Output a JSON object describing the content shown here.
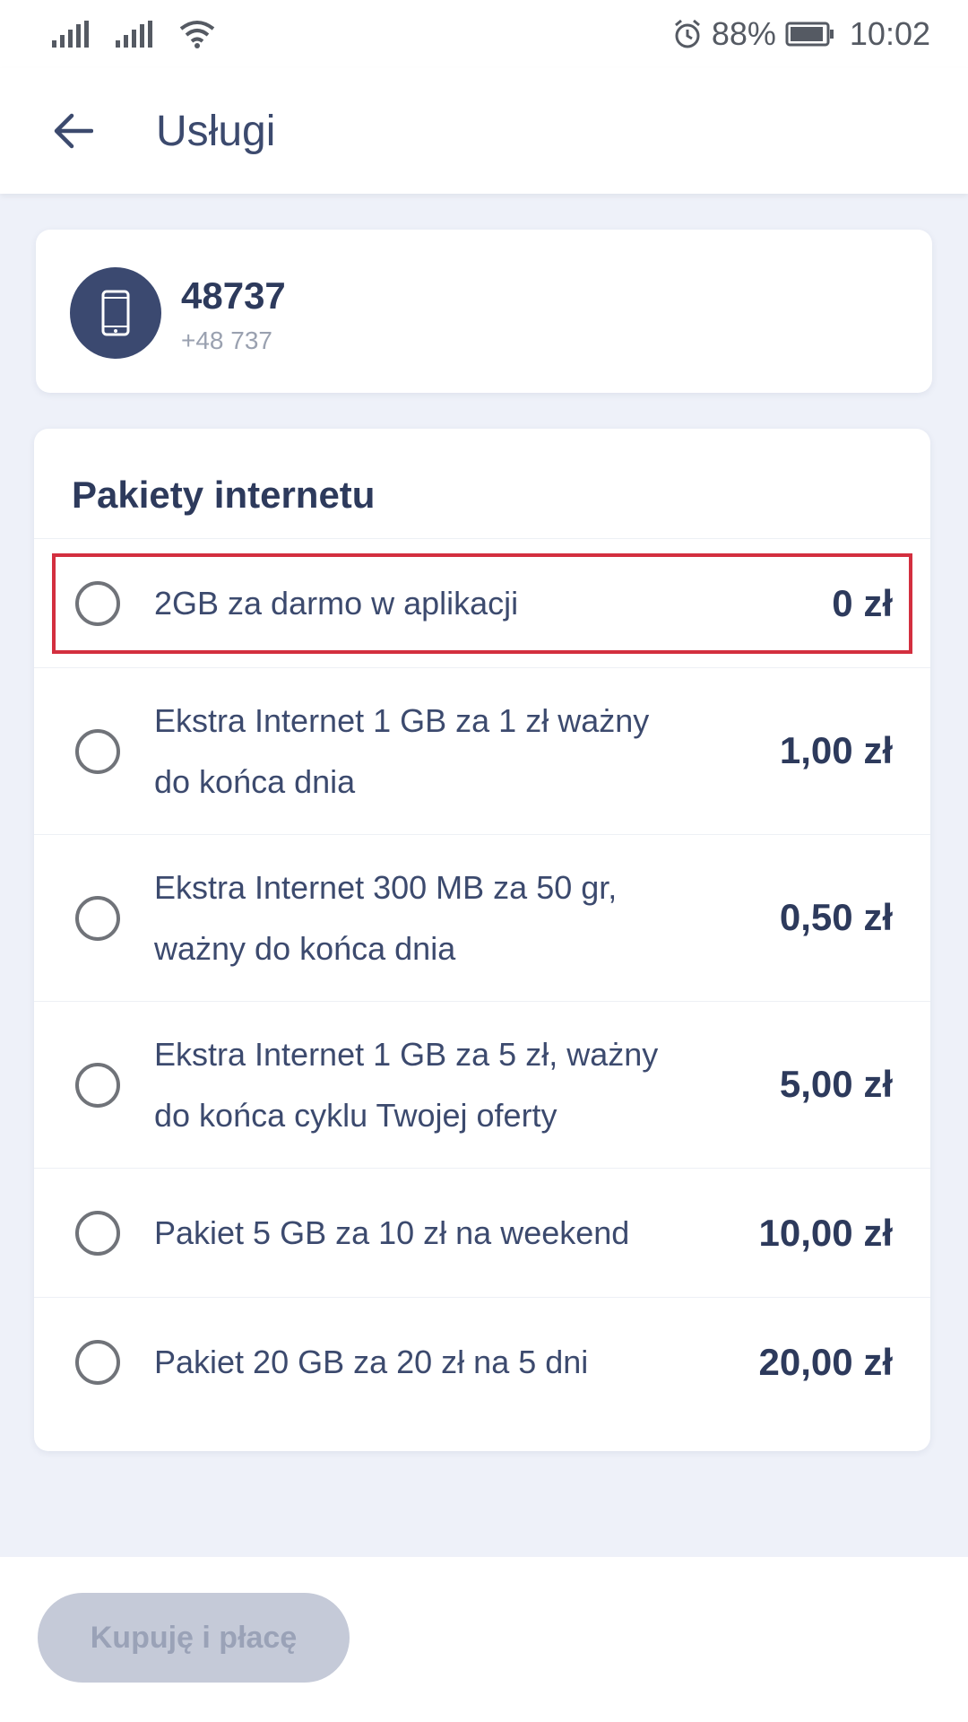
{
  "status_bar": {
    "battery_percent": "88%",
    "time": "10:02",
    "icons": [
      "signal-icon",
      "signal-icon",
      "wifi-icon",
      "alarm-icon",
      "battery-icon"
    ]
  },
  "app_bar": {
    "title": "Usługi",
    "back_icon": "arrow-left-icon"
  },
  "phone": {
    "name": "48737",
    "number": "+48 737",
    "icon": "smartphone-icon"
  },
  "packages": {
    "title": "Pakiety internetu",
    "items": [
      {
        "label": "2GB za darmo w aplikacji",
        "price": "0 zł"
      },
      {
        "label": "Ekstra Internet 1 GB za 1 zł ważny do końca dnia",
        "price": "1,00 zł"
      },
      {
        "label": "Ekstra Internet 300 MB za 50 gr, ważny do końca dnia",
        "price": "0,50 zł"
      },
      {
        "label": "Ekstra Internet 1 GB za 5 zł, ważny do końca cyklu Twojej oferty",
        "price": "5,00 zł"
      },
      {
        "label": "Pakiet 5 GB za 10 zł na weekend",
        "price": "10,00 zł"
      },
      {
        "label": "Pakiet 20 GB za 20 zł na 5 dni",
        "price": "20,00 zł"
      }
    ]
  },
  "actions": {
    "buy_label": "Kupuję i płacę"
  },
  "colors": {
    "accent": "#3b4970",
    "background": "#eef1f9",
    "highlight": "#d32f3f",
    "button_disabled": "#c5cad8"
  }
}
